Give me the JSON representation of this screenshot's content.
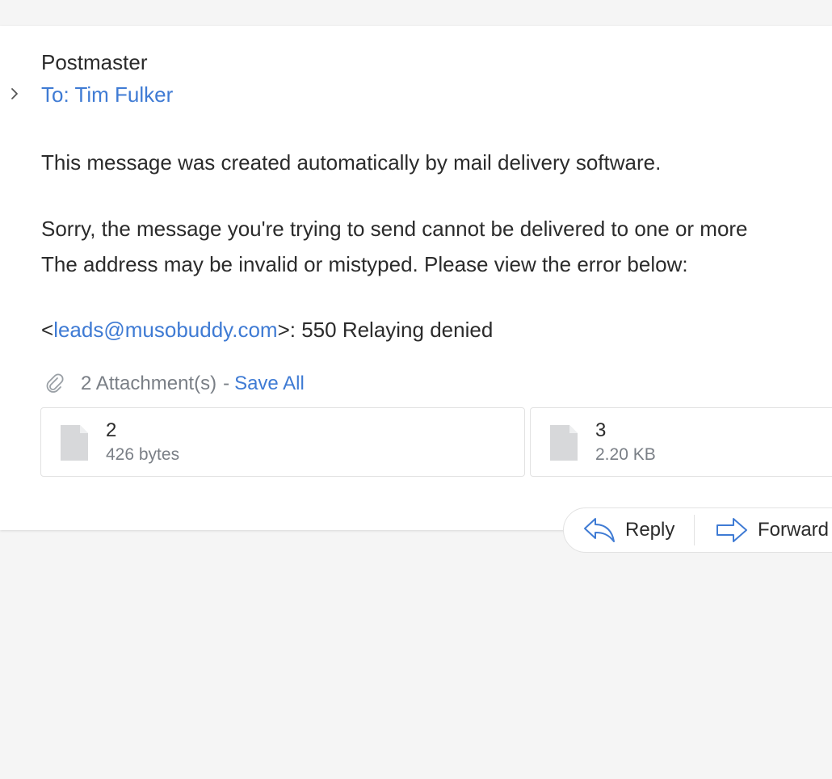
{
  "message": {
    "sender": "Postmaster",
    "to_line": "To: Tim Fulker",
    "body": {
      "line1": "This message was created automatically by mail delivery software.",
      "line2": "Sorry, the message you're trying to send cannot be delivered to one or more",
      "line3": "The address may be invalid or mistyped. Please view the error below:",
      "error_prefix": "<",
      "error_email": "leads@musobuddy.com",
      "error_suffix": ">: 550 Relaying denied"
    }
  },
  "attachments": {
    "count_label": "2 Attachment(s)",
    "separator": "-",
    "save_all_label": "Save All",
    "items": [
      {
        "name": "2",
        "size": "426 bytes"
      },
      {
        "name": "3",
        "size": "2.20 KB"
      }
    ]
  },
  "actions": {
    "reply_label": "Reply",
    "forward_label": "Forward"
  },
  "colors": {
    "link": "#3f7bd4",
    "text": "#2b2b2b",
    "muted": "#7a7f86",
    "background": "#f5f5f5"
  }
}
